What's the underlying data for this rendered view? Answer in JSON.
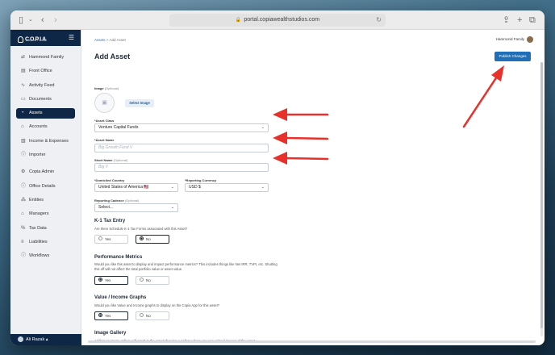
{
  "browser": {
    "url": "portal.copiawealthstudios.com"
  },
  "sidebar": {
    "logo": "COPIA",
    "logo_sub": "Admin Portal",
    "items": [
      {
        "label": "Hammond Family",
        "icon": "arrows-icon"
      },
      {
        "label": "Front Office",
        "icon": "building-icon"
      },
      {
        "label": "Activity Feed",
        "icon": "pulse-icon"
      },
      {
        "label": "Documents",
        "icon": "document-icon"
      },
      {
        "label": "Assets",
        "icon": "assets-icon",
        "active": true
      },
      {
        "label": "Accounts",
        "icon": "bank-icon"
      },
      {
        "label": "Income & Expenses",
        "icon": "chart-icon"
      },
      {
        "label": "Importer",
        "icon": "info-icon"
      },
      {
        "label": "Copia Admin",
        "icon": "gear-icon"
      },
      {
        "label": "Office Details",
        "icon": "info-icon"
      },
      {
        "label": "Entities",
        "icon": "org-icon"
      },
      {
        "label": "Managers",
        "icon": "bank-icon"
      },
      {
        "label": "Tax Data",
        "icon": "tax-icon"
      },
      {
        "label": "Liabilities",
        "icon": "list-icon"
      },
      {
        "label": "Workflows",
        "icon": "info-icon"
      }
    ],
    "footer_user": "Ali Razak"
  },
  "main": {
    "breadcrumb": {
      "root": "Assets",
      "sep": ">",
      "current": "Add Asset"
    },
    "user": "Hammond Family",
    "title": "Add Asset",
    "publish_label": "Publish Changes",
    "image": {
      "label": "Image",
      "optional": "(Optional)",
      "button": "Select Image"
    },
    "asset_class": {
      "label": "*Asset Class",
      "value": "Venture Capital Funds"
    },
    "asset_name": {
      "label": "*Asset Name",
      "placeholder": "Big Growth Fund V"
    },
    "short_name": {
      "label": "Short Name",
      "optional": "(Optional)",
      "placeholder": "Big V"
    },
    "domiciled_country": {
      "label": "*Domiciled Country",
      "value": "United States of America 🇺🇸"
    },
    "reporting_currency": {
      "label": "*Reporting Currency",
      "value": "USD $"
    },
    "reporting_cadence": {
      "label": "Reporting Cadence",
      "optional": "(Optional)",
      "value": "Select..."
    },
    "k1": {
      "title": "K-1 Tax Entry",
      "desc": "Are there Schedule K-1 Tax Forms associated with this Asset?",
      "yes": "Yes",
      "no": "No",
      "selected": "no"
    },
    "performance": {
      "title": "Performance Metrics",
      "desc": "Would you like this asset to display and impact performance metrics? This includes things like Net IRR, TVPI, etc. Shutting this off will not affect the total portfolio value or asset value.",
      "yes": "Yes",
      "no": "No",
      "selected": "yes"
    },
    "graphs": {
      "title": "Value / Income Graphs",
      "desc": "Would you like Value and Income graphs to display on the Copia App for this asset?",
      "yes": "Yes",
      "no": "No",
      "selected": "yes"
    },
    "gallery": {
      "title": "Image Gallery",
      "desc": "Adding an image gallery will result in the asset showing a gallery where you can upload images of the asset."
    }
  },
  "colors": {
    "navy": "#0f2747",
    "accent": "#1f6fb8",
    "annotation": "#e8312a"
  }
}
